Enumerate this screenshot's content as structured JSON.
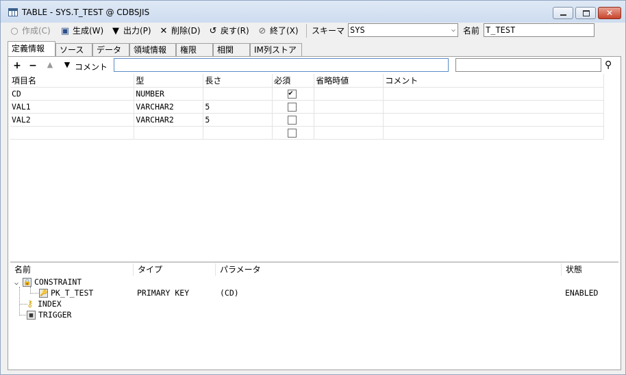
{
  "window": {
    "title": "TABLE - SYS.T_TEST @ CDBSJIS",
    "close_label": "✕"
  },
  "toolbar": {
    "create": "作成(C)",
    "generate": "生成(W)",
    "output": "出力(P)",
    "delete": "削除(D)",
    "revert": "戻す(R)",
    "exit": "終了(X)",
    "schema_label": "スキーマ",
    "schema_value": "SYS",
    "name_label": "名前",
    "name_value": "T_TEST"
  },
  "tabs": [
    "定義情報",
    "ソース",
    "データ",
    "領域情報",
    "権限",
    "相関",
    "IM列ストア"
  ],
  "columns_toolbar": {
    "comment_label": "コメント",
    "comment_value": "",
    "search_value": ""
  },
  "columns_grid": {
    "headers": [
      "項目名",
      "型",
      "長さ",
      "必須",
      "省略時値",
      "コメント"
    ],
    "rows": [
      {
        "name": "CD",
        "type": "NUMBER",
        "length": "",
        "required": true,
        "default": "",
        "comment": ""
      },
      {
        "name": "VAL1",
        "type": "VARCHAR2",
        "length": "5",
        "required": false,
        "default": "",
        "comment": ""
      },
      {
        "name": "VAL2",
        "type": "VARCHAR2",
        "length": "5",
        "required": false,
        "default": "",
        "comment": ""
      },
      {
        "name": "",
        "type": "",
        "length": "",
        "required": false,
        "default": "",
        "comment": ""
      }
    ]
  },
  "object_tree": {
    "headers": [
      "名前",
      "タイプ",
      "パラメータ",
      "状態"
    ],
    "constraint": "CONSTRAINT",
    "pk": {
      "name": "PK_T_TEST",
      "type": "PRIMARY KEY",
      "params": "(CD)",
      "status": "ENABLED"
    },
    "index": "INDEX",
    "trigger": "TRIGGER"
  }
}
